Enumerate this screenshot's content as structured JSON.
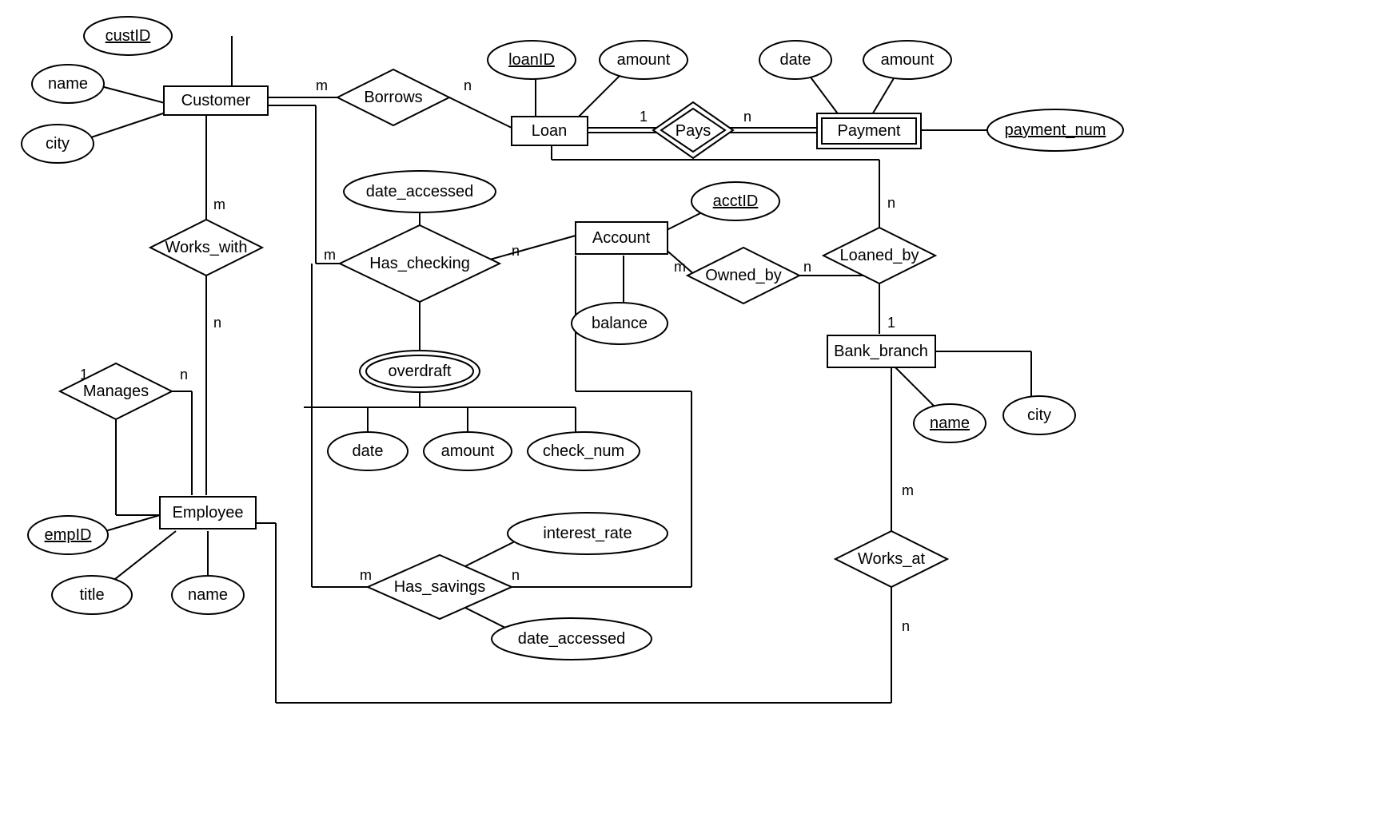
{
  "entities": {
    "customer": "Customer",
    "loan": "Loan",
    "payment": "Payment",
    "account": "Account",
    "bank_branch": "Bank_branch",
    "employee": "Employee"
  },
  "relationships": {
    "borrows": "Borrows",
    "pays": "Pays",
    "works_with": "Works_with",
    "has_checking": "Has_checking",
    "owned_by": "Owned_by",
    "loaned_by": "Loaned_by",
    "manages": "Manages",
    "has_savings": "Has_savings",
    "works_at": "Works_at"
  },
  "attributes": {
    "custID": "custID",
    "cust_name": "name",
    "cust_city": "city",
    "loanID": "loanID",
    "loan_amount": "amount",
    "pay_date": "date",
    "pay_amount": "amount",
    "payment_num": "payment_num",
    "date_accessed1": "date_accessed",
    "overdraft": "overdraft",
    "od_date": "date",
    "od_amount": "amount",
    "od_checknum": "check_num",
    "acctID": "acctID",
    "balance": "balance",
    "emp_empID": "empID",
    "emp_title": "title",
    "emp_name": "name",
    "interest_rate": "interest_rate",
    "date_accessed2": "date_accessed",
    "branch_name": "name",
    "branch_city": "city"
  },
  "card": {
    "m": "m",
    "n": "n",
    "one": "1"
  }
}
